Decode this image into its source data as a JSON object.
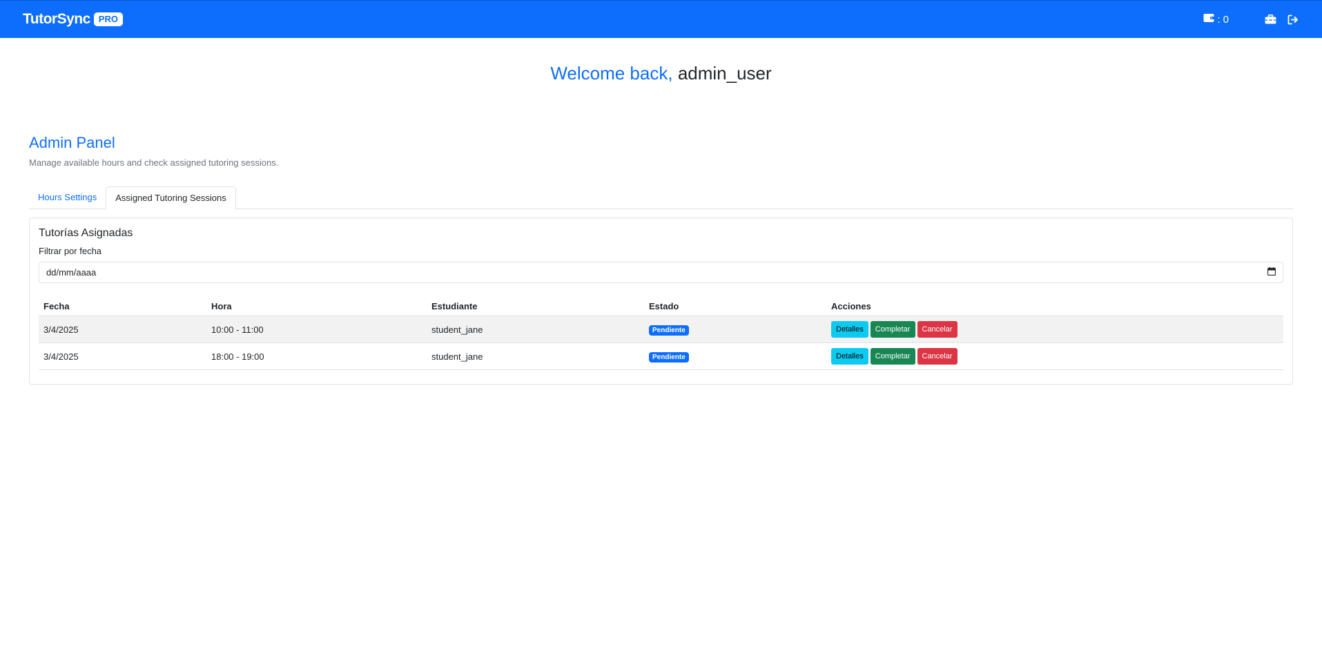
{
  "navbar": {
    "brand": "TutorSync",
    "badge": "PRO",
    "credits": ": 0",
    "icons": [
      "wallet-icon",
      "toolbox-icon",
      "logout-icon"
    ]
  },
  "welcome": {
    "greeting": "Welcome back,",
    "username": "admin_user"
  },
  "panel": {
    "title": "Admin Panel",
    "subtitle": "Manage available hours and check assigned tutoring sessions."
  },
  "tabs": [
    {
      "label": "Hours Settings",
      "active": false
    },
    {
      "label": "Assigned Tutoring Sessions",
      "active": true
    }
  ],
  "sessions": {
    "title": "Tutorías Asignadas",
    "filter_label": "Filtrar por fecha",
    "filter_placeholder": "dd/mm/aaaa",
    "columns": [
      "Fecha",
      "Hora",
      "Estudiante",
      "Estado",
      "Acciones"
    ],
    "rows": [
      {
        "fecha": "3/4/2025",
        "hora": "10:00 - 11:00",
        "estudiante": "student_jane",
        "estado": "Pendiente"
      },
      {
        "fecha": "3/4/2025",
        "hora": "18:00 - 19:00",
        "estudiante": "student_jane",
        "estado": "Pendiente"
      }
    ],
    "actions": {
      "details": "Detalles",
      "complete": "Completar",
      "cancel": "Cancelar"
    }
  },
  "colors": {
    "primary": "#0d6efd",
    "info": "#0dcaf0",
    "success": "#198754",
    "danger": "#dc3545"
  }
}
